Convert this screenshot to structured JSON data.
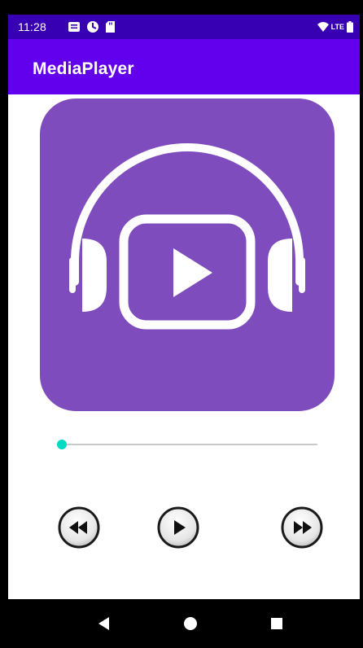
{
  "status_bar": {
    "time": "11:28",
    "network_label": "LTE",
    "left_icons": [
      "notification-icon",
      "sync-icon",
      "sd-card-icon"
    ],
    "right_icons": [
      "wifi-icon",
      "battery-icon"
    ]
  },
  "app_bar": {
    "title": "MediaPlayer",
    "color": "#6200ee"
  },
  "status_bar_color": "#3700b3",
  "album_art": {
    "icon": "headphones-play-icon",
    "background_color": "#7e4cbd"
  },
  "seek_bar": {
    "progress_fraction": 0.0,
    "accent_color": "#03dac5"
  },
  "controls": [
    {
      "id": "rewind",
      "icon": "rewind-icon"
    },
    {
      "id": "play",
      "icon": "play-icon"
    },
    {
      "id": "fast-forward",
      "icon": "fast-forward-icon"
    }
  ],
  "nav_bar": {
    "buttons": [
      "back-icon",
      "home-icon",
      "recents-icon"
    ]
  }
}
